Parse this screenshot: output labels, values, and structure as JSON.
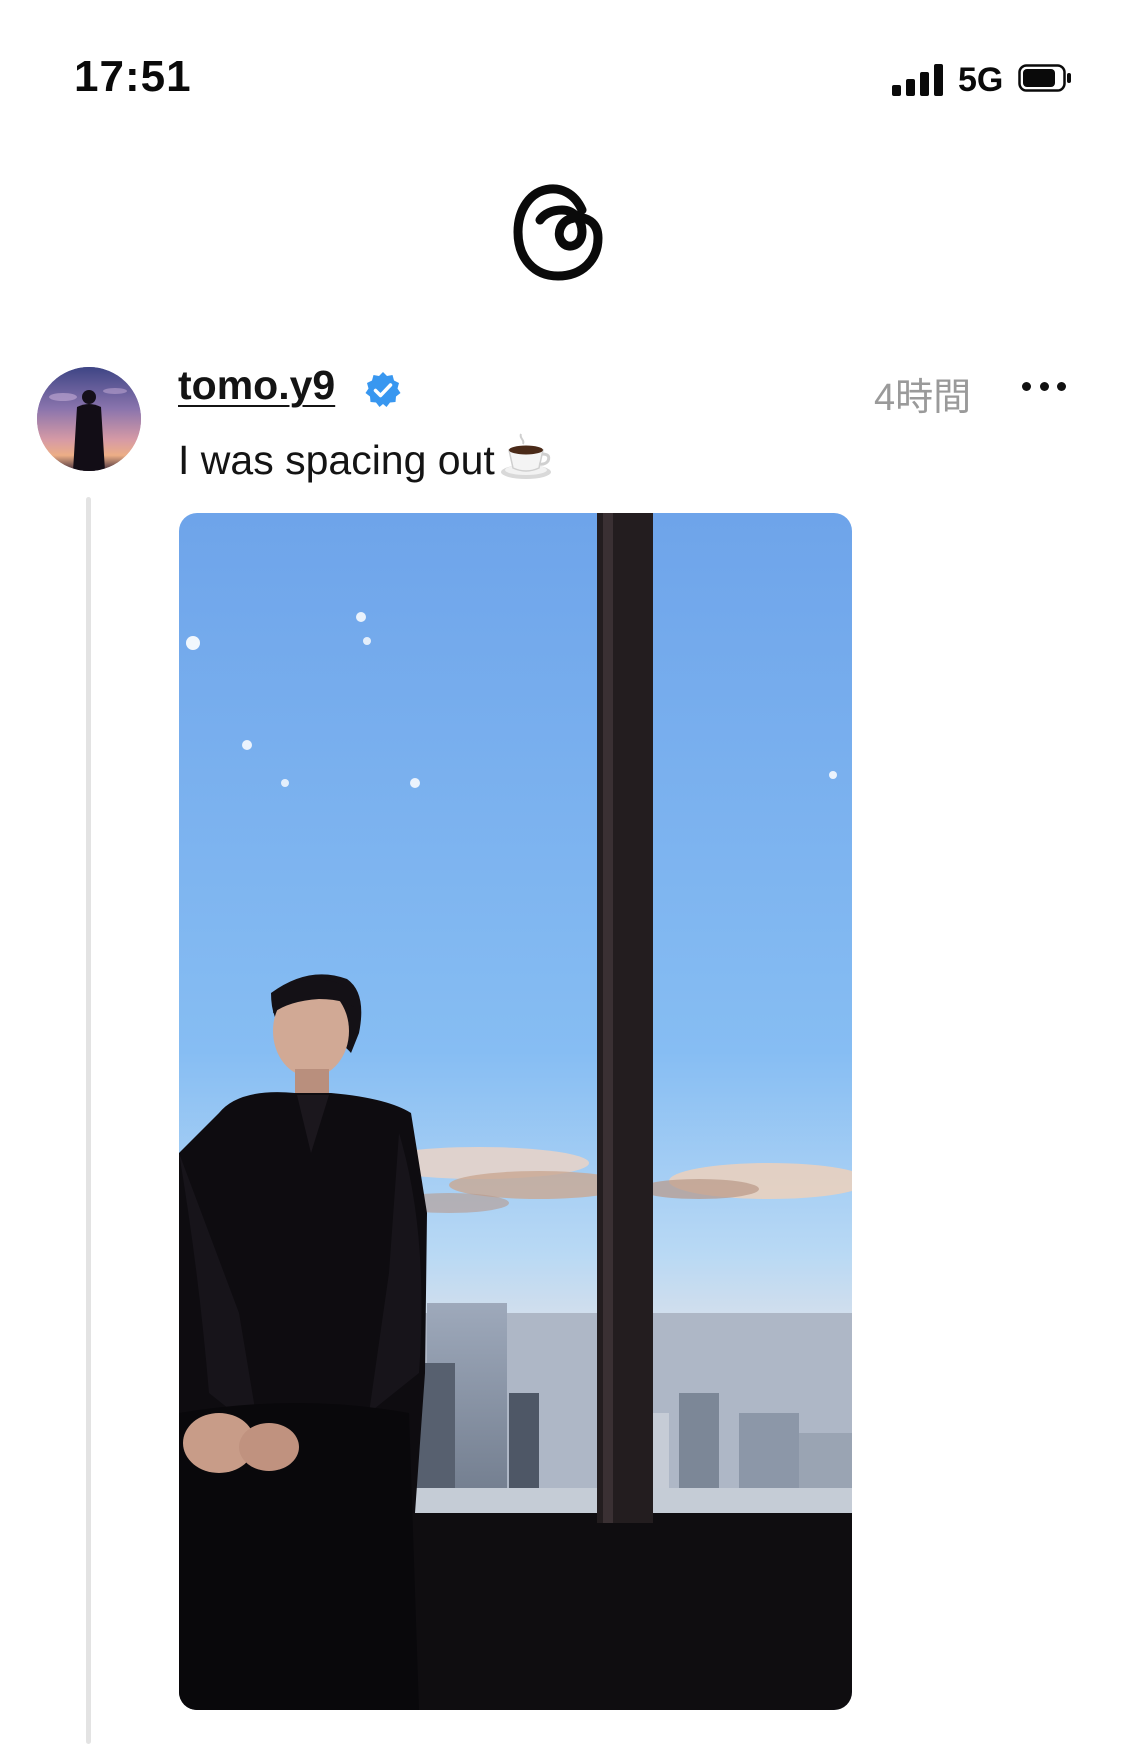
{
  "status_bar": {
    "time": "17:51",
    "network": "5G",
    "signal_bars": 4,
    "battery_level": 0.75
  },
  "header": {
    "logo_icon": "threads-logo-icon"
  },
  "post": {
    "username": "tomo.y9",
    "verified": true,
    "verified_icon": "verified-badge-icon",
    "timestamp": "4時間",
    "more_icon": "more-horizontal-icon",
    "text": "I was spacing out",
    "emoji_icon": "coffee-cup-icon",
    "image_alt": "man in black suit sitting by a tall window overlooking a city skyline at dusk"
  },
  "colors": {
    "accent_verified": "#3897f0",
    "timestamp_gray": "#9a9a9a",
    "thread_line": "#e3e3e3"
  }
}
